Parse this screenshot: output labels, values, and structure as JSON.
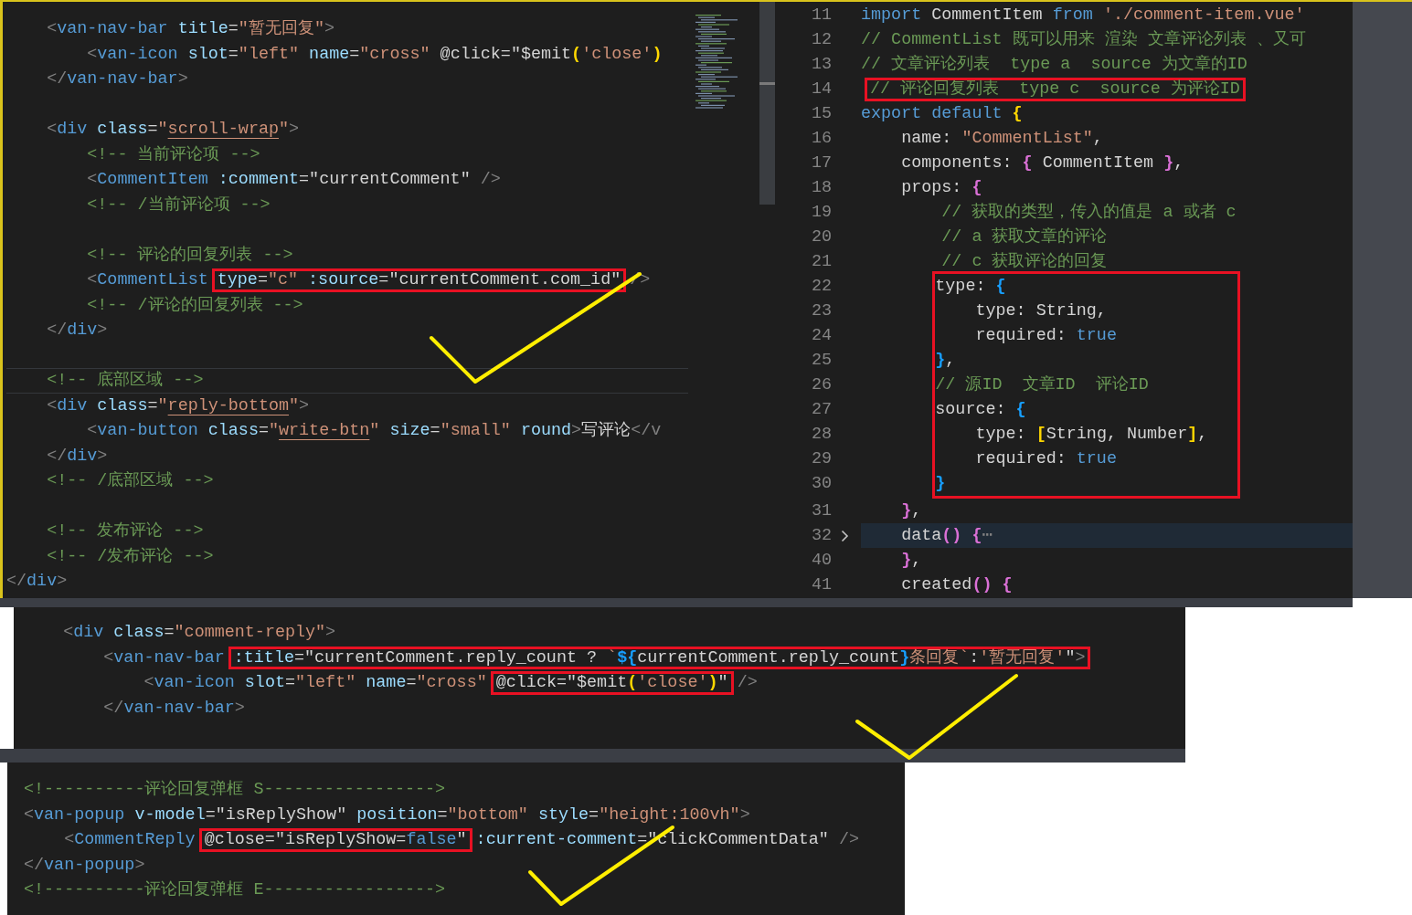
{
  "template_editor": {
    "lines": [
      {
        "kind": "code",
        "current": false,
        "segments": [
          {
            "boxed": false,
            "tokens": [
              {
                "text": "    <",
                "kind": "punct"
              },
              {
                "text": "van-nav-bar",
                "kind": "tag"
              },
              {
                "text": " title",
                "kind": "attribute"
              },
              {
                "text": "=",
                "kind": "plain"
              },
              {
                "text": "\"暂无回复\"",
                "kind": "string"
              },
              {
                "text": ">",
                "kind": "punct"
              }
            ]
          }
        ]
      },
      {
        "kind": "code",
        "current": false,
        "segments": [
          {
            "boxed": false,
            "tokens": [
              {
                "text": "        <",
                "kind": "punct"
              },
              {
                "text": "van-icon",
                "kind": "tag"
              },
              {
                "text": " slot",
                "kind": "attribute"
              },
              {
                "text": "=",
                "kind": "plain"
              },
              {
                "text": "\"left\"",
                "kind": "string"
              },
              {
                "text": " name",
                "kind": "attribute"
              },
              {
                "text": "=",
                "kind": "plain"
              },
              {
                "text": "\"cross\"",
                "kind": "string"
              },
              {
                "text": " @click",
                "kind": "plain"
              },
              {
                "text": "=",
                "kind": "plain"
              },
              {
                "text": "\"$emit",
                "kind": "plain"
              },
              {
                "text": "(",
                "kind": "bracket",
                "color": "#ffd700"
              },
              {
                "text": "'close'",
                "kind": "string"
              },
              {
                "text": ")",
                "kind": "bracket",
                "color": "#ffd700"
              }
            ]
          }
        ]
      },
      {
        "kind": "code",
        "current": false,
        "segments": [
          {
            "boxed": false,
            "tokens": [
              {
                "text": "    </",
                "kind": "punct"
              },
              {
                "text": "van-nav-bar",
                "kind": "tag"
              },
              {
                "text": ">",
                "kind": "punct"
              }
            ]
          }
        ]
      },
      {
        "kind": "blank",
        "current": false
      },
      {
        "kind": "code",
        "current": false,
        "segments": [
          {
            "boxed": false,
            "tokens": [
              {
                "text": "    <",
                "kind": "punct"
              },
              {
                "text": "div",
                "kind": "tag"
              },
              {
                "text": " class",
                "kind": "attribute"
              },
              {
                "text": "=",
                "kind": "plain"
              },
              {
                "text": "\"",
                "kind": "string"
              },
              {
                "text": "scroll-wrap",
                "kind": "underlined"
              },
              {
                "text": "\"",
                "kind": "string"
              },
              {
                "text": ">",
                "kind": "punct"
              }
            ]
          }
        ]
      },
      {
        "kind": "code",
        "current": false,
        "segments": [
          {
            "boxed": false,
            "tokens": [
              {
                "text": "        <!-- 当前评论项 -->",
                "kind": "comment"
              }
            ]
          }
        ]
      },
      {
        "kind": "code",
        "current": false,
        "segments": [
          {
            "boxed": false,
            "tokens": [
              {
                "text": "        <",
                "kind": "punct"
              },
              {
                "text": "CommentItem",
                "kind": "tag"
              },
              {
                "text": " :comment",
                "kind": "attribute"
              },
              {
                "text": "=",
                "kind": "plain"
              },
              {
                "text": "\"currentComment\"",
                "kind": "plain"
              },
              {
                "text": " />",
                "kind": "punct"
              }
            ]
          }
        ]
      },
      {
        "kind": "code",
        "current": false,
        "segments": [
          {
            "boxed": false,
            "tokens": [
              {
                "text": "        <!-- /当前评论项 -->",
                "kind": "comment"
              }
            ]
          }
        ]
      },
      {
        "kind": "blank",
        "current": false
      },
      {
        "kind": "code",
        "current": false,
        "segments": [
          {
            "boxed": false,
            "tokens": [
              {
                "text": "        <!-- 评论的回复列表 -->",
                "kind": "comment"
              }
            ]
          }
        ]
      },
      {
        "kind": "code",
        "current": false,
        "segments": [
          {
            "boxed": false,
            "tokens": [
              {
                "text": "        <",
                "kind": "punct"
              },
              {
                "text": "CommentList",
                "kind": "tag"
              }
            ]
          },
          {
            "boxed": true,
            "tokens": [
              {
                "text": "type",
                "kind": "attribute"
              },
              {
                "text": "=",
                "kind": "plain"
              },
              {
                "text": "\"c\"",
                "kind": "string"
              },
              {
                "text": " :source",
                "kind": "attribute"
              },
              {
                "text": "=",
                "kind": "plain"
              },
              {
                "text": "\"currentComment.com_id\"",
                "kind": "plain"
              }
            ]
          },
          {
            "boxed": false,
            "tokens": [
              {
                "text": "/>",
                "kind": "punct"
              }
            ]
          }
        ]
      },
      {
        "kind": "code",
        "current": false,
        "segments": [
          {
            "boxed": false,
            "tokens": [
              {
                "text": "        <!-- /评论的回复列表 -->",
                "kind": "comment"
              }
            ]
          }
        ]
      },
      {
        "kind": "code",
        "current": false,
        "segments": [
          {
            "boxed": false,
            "tokens": [
              {
                "text": "    </",
                "kind": "punct"
              },
              {
                "text": "div",
                "kind": "tag"
              },
              {
                "text": ">",
                "kind": "punct"
              }
            ]
          }
        ]
      },
      {
        "kind": "blank",
        "current": false
      },
      {
        "kind": "code",
        "current": true,
        "segments": [
          {
            "boxed": false,
            "tokens": [
              {
                "text": "    <!-- 底部区域 -->",
                "kind": "comment"
              }
            ]
          }
        ]
      },
      {
        "kind": "code",
        "current": false,
        "segments": [
          {
            "boxed": false,
            "tokens": [
              {
                "text": "    <",
                "kind": "punct"
              },
              {
                "text": "div",
                "kind": "tag"
              },
              {
                "text": " class",
                "kind": "attribute"
              },
              {
                "text": "=",
                "kind": "plain"
              },
              {
                "text": "\"",
                "kind": "string"
              },
              {
                "text": "reply-bottom",
                "kind": "underlined"
              },
              {
                "text": "\"",
                "kind": "string"
              },
              {
                "text": ">",
                "kind": "punct"
              }
            ]
          }
        ]
      },
      {
        "kind": "code",
        "current": false,
        "segments": [
          {
            "boxed": false,
            "tokens": [
              {
                "text": "        <",
                "kind": "punct"
              },
              {
                "text": "van-button",
                "kind": "tag"
              },
              {
                "text": " class",
                "kind": "attribute"
              },
              {
                "text": "=",
                "kind": "plain"
              },
              {
                "text": "\"",
                "kind": "string"
              },
              {
                "text": "write-btn",
                "kind": "underlined"
              },
              {
                "text": "\"",
                "kind": "string"
              },
              {
                "text": " size",
                "kind": "attribute"
              },
              {
                "text": "=",
                "kind": "plain"
              },
              {
                "text": "\"small\"",
                "kind": "string"
              },
              {
                "text": " round",
                "kind": "attribute"
              },
              {
                "text": ">",
                "kind": "punct"
              },
              {
                "text": "写评论",
                "kind": "plain"
              },
              {
                "text": "</v",
                "kind": "punct"
              }
            ]
          }
        ]
      },
      {
        "kind": "code",
        "current": false,
        "segments": [
          {
            "boxed": false,
            "tokens": [
              {
                "text": "    </",
                "kind": "punct"
              },
              {
                "text": "div",
                "kind": "tag"
              },
              {
                "text": ">",
                "kind": "punct"
              }
            ]
          }
        ]
      },
      {
        "kind": "code",
        "current": false,
        "segments": [
          {
            "boxed": false,
            "tokens": [
              {
                "text": "    <!-- /底部区域 -->",
                "kind": "comment"
              }
            ]
          }
        ]
      },
      {
        "kind": "blank",
        "current": false
      },
      {
        "kind": "code",
        "current": false,
        "segments": [
          {
            "boxed": false,
            "tokens": [
              {
                "text": "    <!-- 发布评论 -->",
                "kind": "comment"
              }
            ]
          }
        ]
      },
      {
        "kind": "code",
        "current": false,
        "segments": [
          {
            "boxed": false,
            "tokens": [
              {
                "text": "    <!-- /发布评论 -->",
                "kind": "comment"
              }
            ]
          }
        ]
      },
      {
        "kind": "code",
        "current": false,
        "segments": [
          {
            "boxed": false,
            "tokens": [
              {
                "text": "</",
                "kind": "punct"
              },
              {
                "text": "div",
                "kind": "tag"
              },
              {
                "text": ">",
                "kind": "punct"
              }
            ]
          }
        ]
      }
    ]
  },
  "script_editor": {
    "lines": [
      {
        "kind": "code",
        "number": "11",
        "current": false,
        "folded": false,
        "segments": [
          {
            "boxed": false,
            "tokens": [
              {
                "text": "import",
                "kind": "keyword"
              },
              {
                "text": " CommentItem ",
                "kind": "plain"
              },
              {
                "text": "from",
                "kind": "keyword"
              },
              {
                "text": " './comment-item.vue'",
                "kind": "string"
              }
            ]
          }
        ]
      },
      {
        "kind": "code",
        "number": "12",
        "current": false,
        "folded": false,
        "segments": [
          {
            "boxed": false,
            "tokens": [
              {
                "text": "// CommentList 既可以用来 渲染 文章评论列表 、又可",
                "kind": "comment"
              }
            ]
          }
        ]
      },
      {
        "kind": "code",
        "number": "13",
        "current": false,
        "folded": false,
        "segments": [
          {
            "boxed": false,
            "tokens": [
              {
                "text": "// 文章评论列表  type a  source 为文章的ID",
                "kind": "comment"
              }
            ]
          }
        ]
      },
      {
        "kind": "code",
        "number": "14",
        "current": false,
        "folded": false,
        "segments": [
          {
            "boxed": true,
            "tokens": [
              {
                "text": "// 评论回复列表  type c  source 为评论ID",
                "kind": "comment"
              }
            ]
          }
        ]
      },
      {
        "kind": "code",
        "number": "15",
        "current": false,
        "folded": false,
        "segments": [
          {
            "boxed": false,
            "tokens": [
              {
                "text": "export default ",
                "kind": "keyword"
              },
              {
                "text": "{",
                "kind": "bracket",
                "color": "#ffd700"
              }
            ]
          }
        ]
      },
      {
        "kind": "code",
        "number": "16",
        "current": false,
        "folded": false,
        "segments": [
          {
            "boxed": false,
            "tokens": [
              {
                "text": "    name: ",
                "kind": "plain"
              },
              {
                "text": "\"CommentList\"",
                "kind": "string"
              },
              {
                "text": ",",
                "kind": "plain"
              }
            ]
          }
        ]
      },
      {
        "kind": "code",
        "number": "17",
        "current": false,
        "folded": false,
        "segments": [
          {
            "boxed": false,
            "tokens": [
              {
                "text": "    components: ",
                "kind": "plain"
              },
              {
                "text": "{",
                "kind": "bracket",
                "color": "#da70d6"
              },
              {
                "text": " CommentItem ",
                "kind": "plain"
              },
              {
                "text": "}",
                "kind": "bracket",
                "color": "#da70d6"
              },
              {
                "text": ",",
                "kind": "plain"
              }
            ]
          }
        ]
      },
      {
        "kind": "code",
        "number": "18",
        "current": false,
        "folded": false,
        "segments": [
          {
            "boxed": false,
            "tokens": [
              {
                "text": "    props: ",
                "kind": "plain"
              },
              {
                "text": "{",
                "kind": "bracket",
                "color": "#da70d6"
              }
            ]
          }
        ]
      },
      {
        "kind": "code",
        "number": "19",
        "current": false,
        "folded": false,
        "segments": [
          {
            "boxed": false,
            "tokens": [
              {
                "text": "        // 获取的类型，传入的值是 a 或者 c",
                "kind": "comment"
              }
            ]
          }
        ]
      },
      {
        "kind": "code",
        "number": "20",
        "current": false,
        "folded": false,
        "segments": [
          {
            "boxed": false,
            "tokens": [
              {
                "text": "        // a 获取文章的评论",
                "kind": "comment"
              }
            ]
          }
        ]
      },
      {
        "kind": "code",
        "number": "21",
        "current": false,
        "folded": false,
        "segments": [
          {
            "boxed": false,
            "tokens": [
              {
                "text": "        // c 获取评论的回复",
                "kind": "comment"
              }
            ]
          }
        ]
      },
      {
        "kind": "boxed",
        "lines": [
          {
            "number": "22",
            "current": false,
            "folded": false,
            "segments": [
              {
                "boxed": false,
                "tokens": [
                  {
                    "text": "        type: ",
                    "kind": "plain"
                  },
                  {
                    "text": "{",
                    "kind": "bracket",
                    "color": "#179fff"
                  }
                ]
              }
            ]
          },
          {
            "number": "23",
            "current": false,
            "folded": false,
            "segments": [
              {
                "boxed": false,
                "tokens": [
                  {
                    "text": "            type: String,",
                    "kind": "plain"
                  }
                ]
              }
            ]
          },
          {
            "number": "24",
            "current": false,
            "folded": false,
            "segments": [
              {
                "boxed": false,
                "tokens": [
                  {
                    "text": "            required: ",
                    "kind": "plain"
                  },
                  {
                    "text": "true",
                    "kind": "keyword"
                  }
                ]
              }
            ]
          },
          {
            "number": "25",
            "current": false,
            "folded": false,
            "segments": [
              {
                "boxed": false,
                "tokens": [
                  {
                    "text": "        }",
                    "kind": "bracket",
                    "color": "#179fff"
                  },
                  {
                    "text": ",",
                    "kind": "plain"
                  }
                ]
              }
            ]
          },
          {
            "number": "26",
            "current": false,
            "folded": false,
            "segments": [
              {
                "boxed": false,
                "tokens": [
                  {
                    "text": "        // 源ID  文章ID  评论ID",
                    "kind": "comment"
                  }
                ]
              }
            ]
          },
          {
            "number": "27",
            "current": false,
            "folded": false,
            "segments": [
              {
                "boxed": false,
                "tokens": [
                  {
                    "text": "        source: ",
                    "kind": "plain"
                  },
                  {
                    "text": "{",
                    "kind": "bracket",
                    "color": "#179fff"
                  }
                ]
              }
            ]
          },
          {
            "number": "28",
            "current": false,
            "folded": false,
            "segments": [
              {
                "boxed": false,
                "tokens": [
                  {
                    "text": "            type: ",
                    "kind": "plain"
                  },
                  {
                    "text": "[",
                    "kind": "bracket",
                    "color": "#ffd700"
                  },
                  {
                    "text": "String, Number",
                    "kind": "plain"
                  },
                  {
                    "text": "]",
                    "kind": "bracket",
                    "color": "#ffd700"
                  },
                  {
                    "text": ",",
                    "kind": "plain"
                  }
                ]
              }
            ]
          },
          {
            "number": "29",
            "current": false,
            "folded": false,
            "segments": [
              {
                "boxed": false,
                "tokens": [
                  {
                    "text": "            required: ",
                    "kind": "plain"
                  },
                  {
                    "text": "true",
                    "kind": "keyword"
                  }
                ]
              }
            ]
          },
          {
            "number": "30",
            "current": false,
            "folded": false,
            "segments": [
              {
                "boxed": false,
                "tokens": [
                  {
                    "text": "        }",
                    "kind": "bracket",
                    "color": "#179fff"
                  }
                ]
              }
            ]
          }
        ]
      },
      {
        "kind": "code",
        "number": "31",
        "current": false,
        "folded": false,
        "segments": [
          {
            "boxed": false,
            "tokens": [
              {
                "text": "    }",
                "kind": "bracket",
                "color": "#da70d6"
              },
              {
                "text": ",",
                "kind": "plain"
              }
            ]
          }
        ]
      },
      {
        "kind": "code",
        "number": "32",
        "current": true,
        "folded": true,
        "segments": [
          {
            "boxed": false,
            "tokens": [
              {
                "text": "    data",
                "kind": "plain"
              },
              {
                "text": "()",
                "kind": "bracket",
                "color": "#da70d6"
              },
              {
                "text": " {",
                "kind": "bracket",
                "color": "#da70d6"
              },
              {
                "text": "⋯",
                "kind": "punct"
              }
            ]
          }
        ]
      },
      {
        "kind": "code",
        "number": "40",
        "current": false,
        "folded": false,
        "segments": [
          {
            "boxed": false,
            "tokens": [
              {
                "text": "    }",
                "kind": "bracket",
                "color": "#da70d6"
              },
              {
                "text": ",",
                "kind": "plain"
              }
            ]
          }
        ]
      },
      {
        "kind": "code",
        "number": "41",
        "current": false,
        "folded": false,
        "segments": [
          {
            "boxed": false,
            "tokens": [
              {
                "text": "    created",
                "kind": "plain"
              },
              {
                "text": "()",
                "kind": "bracket",
                "color": "#da70d6"
              },
              {
                "text": " {",
                "kind": "bracket",
                "color": "#da70d6"
              }
            ]
          }
        ]
      }
    ]
  },
  "nav_bar_snippet": {
    "lines": [
      {
        "segments": [
          {
            "boxed": false,
            "tokens": [
              {
                "text": "    <",
                "kind": "punct"
              },
              {
                "text": "div",
                "kind": "tag"
              },
              {
                "text": " class",
                "kind": "attribute"
              },
              {
                "text": "=",
                "kind": "plain"
              },
              {
                "text": "\"comment-reply\"",
                "kind": "string"
              },
              {
                "text": ">",
                "kind": "punct"
              }
            ]
          }
        ]
      },
      {
        "segments": [
          {
            "boxed": false,
            "tokens": [
              {
                "text": "        <",
                "kind": "punct"
              },
              {
                "text": "van-nav-bar",
                "kind": "tag"
              }
            ]
          },
          {
            "boxed": true,
            "tokens": [
              {
                "text": ":title",
                "kind": "attribute"
              },
              {
                "text": "=",
                "kind": "plain"
              },
              {
                "text": "\"currentComment.reply_count ? ",
                "kind": "plain"
              },
              {
                "text": "`",
                "kind": "string"
              },
              {
                "text": "${",
                "kind": "bracket",
                "color": "#179fff"
              },
              {
                "text": "currentComment.reply_count",
                "kind": "plain"
              },
              {
                "text": "}",
                "kind": "bracket",
                "color": "#179fff"
              },
              {
                "text": "条回复`",
                "kind": "string"
              },
              {
                "text": ":",
                "kind": "plain"
              },
              {
                "text": "'暂无回复'",
                "kind": "string"
              },
              {
                "text": "\"",
                "kind": "plain"
              },
              {
                "text": ">",
                "kind": "punct"
              }
            ]
          }
        ]
      },
      {
        "segments": [
          {
            "boxed": false,
            "tokens": [
              {
                "text": "            <",
                "kind": "punct"
              },
              {
                "text": "van-icon",
                "kind": "tag"
              },
              {
                "text": " slot",
                "kind": "attribute"
              },
              {
                "text": "=",
                "kind": "plain"
              },
              {
                "text": "\"left\"",
                "kind": "string"
              },
              {
                "text": " name",
                "kind": "attribute"
              },
              {
                "text": "=",
                "kind": "plain"
              },
              {
                "text": "\"cross\"",
                "kind": "string"
              }
            ]
          },
          {
            "boxed": true,
            "tokens": [
              {
                "text": "@click",
                "kind": "plain"
              },
              {
                "text": "=",
                "kind": "plain"
              },
              {
                "text": "\"$emit",
                "kind": "plain"
              },
              {
                "text": "(",
                "kind": "bracket"
              },
              {
                "text": "'close'",
                "kind": "string"
              },
              {
                "text": ")",
                "kind": "bracket"
              },
              {
                "text": "\"",
                "kind": "plain"
              }
            ]
          },
          {
            "boxed": false,
            "tokens": [
              {
                "text": "/>",
                "kind": "punct"
              }
            ]
          }
        ]
      },
      {
        "segments": [
          {
            "boxed": false,
            "tokens": [
              {
                "text": "        </",
                "kind": "punct"
              },
              {
                "text": "van-nav-bar",
                "kind": "tag"
              },
              {
                "text": ">",
                "kind": "punct"
              }
            ]
          }
        ]
      }
    ]
  },
  "popup_snippet": {
    "lines": [
      {
        "segments": [
          {
            "boxed": false,
            "tokens": [
              {
                "text": "<!----------评论回复弹框 S----------------->",
                "kind": "comment"
              }
            ]
          }
        ]
      },
      {
        "segments": [
          {
            "boxed": false,
            "tokens": [
              {
                "text": "<",
                "kind": "punct"
              },
              {
                "text": "van-popup",
                "kind": "tag"
              },
              {
                "text": " v-model",
                "kind": "attribute"
              },
              {
                "text": "=",
                "kind": "plain"
              },
              {
                "text": "\"isReplyShow\"",
                "kind": "plain"
              },
              {
                "text": " position",
                "kind": "attribute"
              },
              {
                "text": "=",
                "kind": "plain"
              },
              {
                "text": "\"bottom\"",
                "kind": "string"
              },
              {
                "text": " style",
                "kind": "attribute"
              },
              {
                "text": "=",
                "kind": "plain"
              },
              {
                "text": "\"height:100vh\"",
                "kind": "string"
              },
              {
                "text": ">",
                "kind": "punct"
              }
            ]
          }
        ]
      },
      {
        "segments": [
          {
            "boxed": false,
            "tokens": [
              {
                "text": "    <",
                "kind": "punct"
              },
              {
                "text": "CommentReply",
                "kind": "tag"
              }
            ]
          },
          {
            "boxed": true,
            "tokens": [
              {
                "text": "@close",
                "kind": "plain"
              },
              {
                "text": "=",
                "kind": "plain"
              },
              {
                "text": "\"isReplyShow=",
                "kind": "plain"
              },
              {
                "text": "false",
                "kind": "keyword"
              },
              {
                "text": "\"",
                "kind": "plain"
              }
            ]
          },
          {
            "boxed": false,
            "tokens": [
              {
                "text": ":current-comment",
                "kind": "attribute"
              },
              {
                "text": "=",
                "kind": "plain"
              },
              {
                "text": "\"clickCommentData\"",
                "kind": "plain"
              },
              {
                "text": " />",
                "kind": "punct"
              }
            ]
          }
        ]
      },
      {
        "segments": [
          {
            "boxed": false,
            "tokens": [
              {
                "text": "</",
                "kind": "punct"
              },
              {
                "text": "van-popup",
                "kind": "tag"
              },
              {
                "text": ">",
                "kind": "punct"
              }
            ]
          }
        ]
      },
      {
        "segments": [
          {
            "boxed": false,
            "tokens": [
              {
                "text": "<!----------评论回复弹框 E----------------->",
                "kind": "comment"
              }
            ]
          }
        ]
      }
    ]
  }
}
